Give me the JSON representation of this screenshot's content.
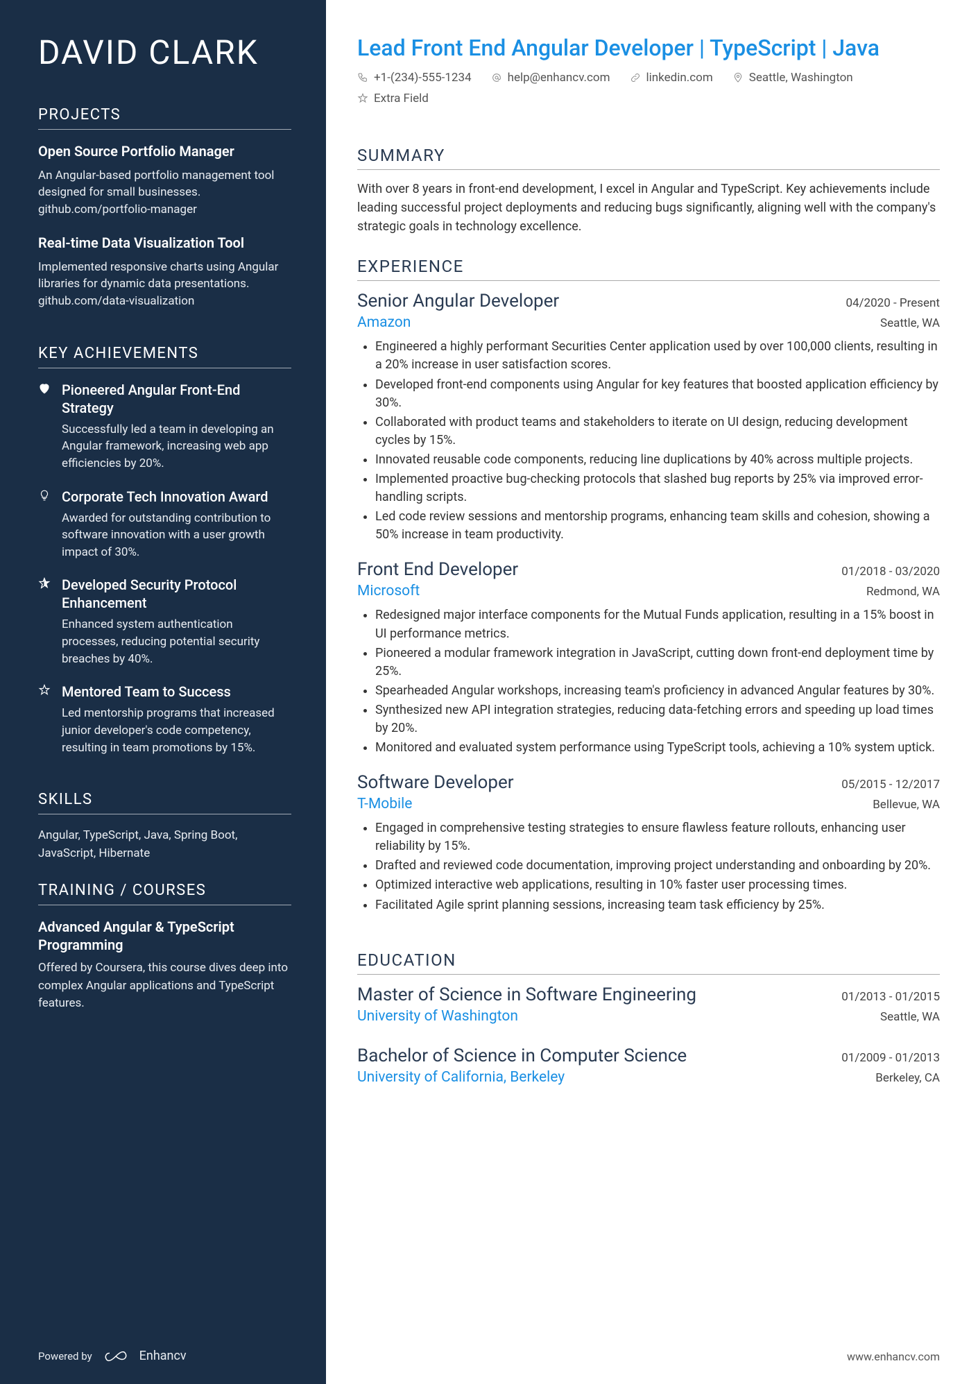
{
  "name": "DAVID CLARK",
  "headline": "Lead Front End Angular Developer | TypeScript | Java",
  "contacts": {
    "phone": "+1-(234)-555-1234",
    "email": "help@enhancv.com",
    "linkedin": "linkedin.com",
    "location": "Seattle, Washington",
    "extra": "Extra Field"
  },
  "sections": {
    "projects": "PROJECTS",
    "achievements": "KEY ACHIEVEMENTS",
    "skills": "SKILLS",
    "training": "TRAINING / COURSES",
    "summary": "SUMMARY",
    "experience": "EXPERIENCE",
    "education": "EDUCATION"
  },
  "projects": [
    {
      "title": "Open Source Portfolio Manager",
      "desc": "An Angular-based portfolio management tool designed for small businesses. github.com/portfolio-manager"
    },
    {
      "title": "Real-time Data Visualization Tool",
      "desc": "Implemented responsive charts using Angular libraries for dynamic data presentations. github.com/data-visualization"
    }
  ],
  "achievements": [
    {
      "title": "Pioneered Angular Front-End Strategy",
      "desc": "Successfully led a team in developing an Angular framework, increasing web app efficiencies by 20%."
    },
    {
      "title": "Corporate Tech Innovation Award",
      "desc": "Awarded for outstanding contribution to software innovation with a user growth impact of 30%."
    },
    {
      "title": "Developed Security Protocol Enhancement",
      "desc": "Enhanced system authentication processes, reducing potential security breaches by 40%."
    },
    {
      "title": "Mentored Team to Success",
      "desc": "Led mentorship programs that increased junior developer's code competency, resulting in team promotions by 15%."
    }
  ],
  "skills": "Angular, TypeScript, Java, Spring Boot, JavaScript, Hibernate",
  "training": {
    "title": "Advanced Angular & TypeScript Programming",
    "desc": "Offered by Coursera, this course dives deep into complex Angular applications and TypeScript features."
  },
  "summary": "With over 8 years in front-end development, I excel in Angular and TypeScript. Key achievements include leading successful project deployments and reducing bugs significantly, aligning well with the company's strategic goals in technology excellence.",
  "experience": [
    {
      "title": "Senior Angular Developer",
      "dates": "04/2020 - Present",
      "company": "Amazon",
      "location": "Seattle, WA",
      "bullets": [
        "Engineered a highly performant Securities Center application used by over 100,000 clients, resulting in a 20% increase in user satisfaction scores.",
        "Developed front-end components using Angular for key features that boosted application efficiency by 30%.",
        "Collaborated with product teams and stakeholders to iterate on UI design, reducing development cycles by 15%.",
        "Innovated reusable code components, reducing line duplications by 40% across multiple projects.",
        "Implemented proactive bug-checking protocols that slashed bug reports by 25% via improved error-handling scripts.",
        "Led code review sessions and mentorship programs, enhancing team skills and cohesion, showing a 50% increase in team productivity."
      ]
    },
    {
      "title": "Front End Developer",
      "dates": "01/2018 - 03/2020",
      "company": "Microsoft",
      "location": "Redmond, WA",
      "bullets": [
        "Redesigned major interface components for the Mutual Funds application, resulting in a 15% boost in UI performance metrics.",
        "Pioneered a modular framework integration in JavaScript, cutting down front-end deployment time by 25%.",
        "Spearheaded Angular workshops, increasing team's proficiency in advanced Angular features by 30%.",
        "Synthesized new API integration strategies, reducing data-fetching errors and speeding up load times by 20%.",
        "Monitored and evaluated system performance using TypeScript tools, achieving a 10% system uptick."
      ]
    },
    {
      "title": "Software Developer",
      "dates": "05/2015 - 12/2017",
      "company": "T-Mobile",
      "location": "Bellevue, WA",
      "bullets": [
        "Engaged in comprehensive testing strategies to ensure flawless feature rollouts, enhancing user reliability by 15%.",
        "Drafted and reviewed code documentation, improving project understanding and onboarding by 20%.",
        "Optimized interactive web applications, resulting in 10% faster user processing times.",
        "Facilitated Agile sprint planning sessions, increasing team task efficiency by 25%."
      ]
    }
  ],
  "education": [
    {
      "degree": "Master of Science in Software Engineering",
      "dates": "01/2013 - 01/2015",
      "school": "University of Washington",
      "location": "Seattle, WA"
    },
    {
      "degree": "Bachelor of Science in Computer Science",
      "dates": "01/2009 - 01/2013",
      "school": "University of California, Berkeley",
      "location": "Berkeley, CA"
    }
  ],
  "footer": {
    "powered": "Powered by",
    "brand": "Enhancv",
    "url": "www.enhancv.com"
  }
}
